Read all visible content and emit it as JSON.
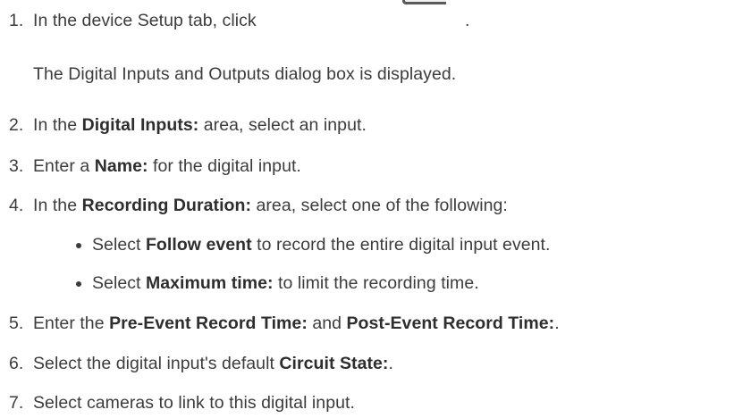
{
  "steps": [
    {
      "number": "1.",
      "parts": [
        {
          "text": "In the device Setup tab, click",
          "bold": false
        }
      ],
      "trailing": "."
    },
    {
      "sub": "The Digital Inputs and Outputs dialog box is displayed."
    },
    {
      "number": "2.",
      "parts": [
        {
          "text": "In the ",
          "bold": false
        },
        {
          "text": "Digital Inputs:",
          "bold": true
        },
        {
          "text": " area, select an input.",
          "bold": false
        }
      ]
    },
    {
      "number": "3.",
      "parts": [
        {
          "text": "Enter a ",
          "bold": false
        },
        {
          "text": "Name:",
          "bold": true
        },
        {
          "text": " for the digital input.",
          "bold": false
        }
      ]
    },
    {
      "number": "4.",
      "parts": [
        {
          "text": "In the ",
          "bold": false
        },
        {
          "text": "Recording Duration:",
          "bold": true
        },
        {
          "text": " area, select one of the following:",
          "bold": false
        }
      ]
    },
    {
      "bullet": [
        {
          "text": "Select ",
          "bold": false
        },
        {
          "text": "Follow event",
          "bold": true
        },
        {
          "text": " to record the entire digital input event.",
          "bold": false
        }
      ]
    },
    {
      "bullet": [
        {
          "text": "Select ",
          "bold": false
        },
        {
          "text": "Maximum time:",
          "bold": true
        },
        {
          "text": " to limit the recording time.",
          "bold": false
        }
      ]
    },
    {
      "number": "5.",
      "parts": [
        {
          "text": "Enter the ",
          "bold": false
        },
        {
          "text": "Pre-Event Record Time:",
          "bold": true
        },
        {
          "text": " and ",
          "bold": false
        },
        {
          "text": "Post-Event Record Time:",
          "bold": true
        },
        {
          "text": ".",
          "bold": false
        }
      ]
    },
    {
      "number": "6.",
      "parts": [
        {
          "text": "Select the digital input's default ",
          "bold": false
        },
        {
          "text": "Circuit State:",
          "bold": true
        },
        {
          "text": ".",
          "bold": false
        }
      ]
    },
    {
      "number": "7.",
      "parts": [
        {
          "text": "Select cameras to link to this digital input.",
          "bold": false
        }
      ]
    }
  ],
  "icons": {
    "setup_button": "dialog-button-icon"
  },
  "colors": {
    "text": "#3c3c3c",
    "bold_text": "#2e2e2e",
    "background": "#ffffff"
  }
}
